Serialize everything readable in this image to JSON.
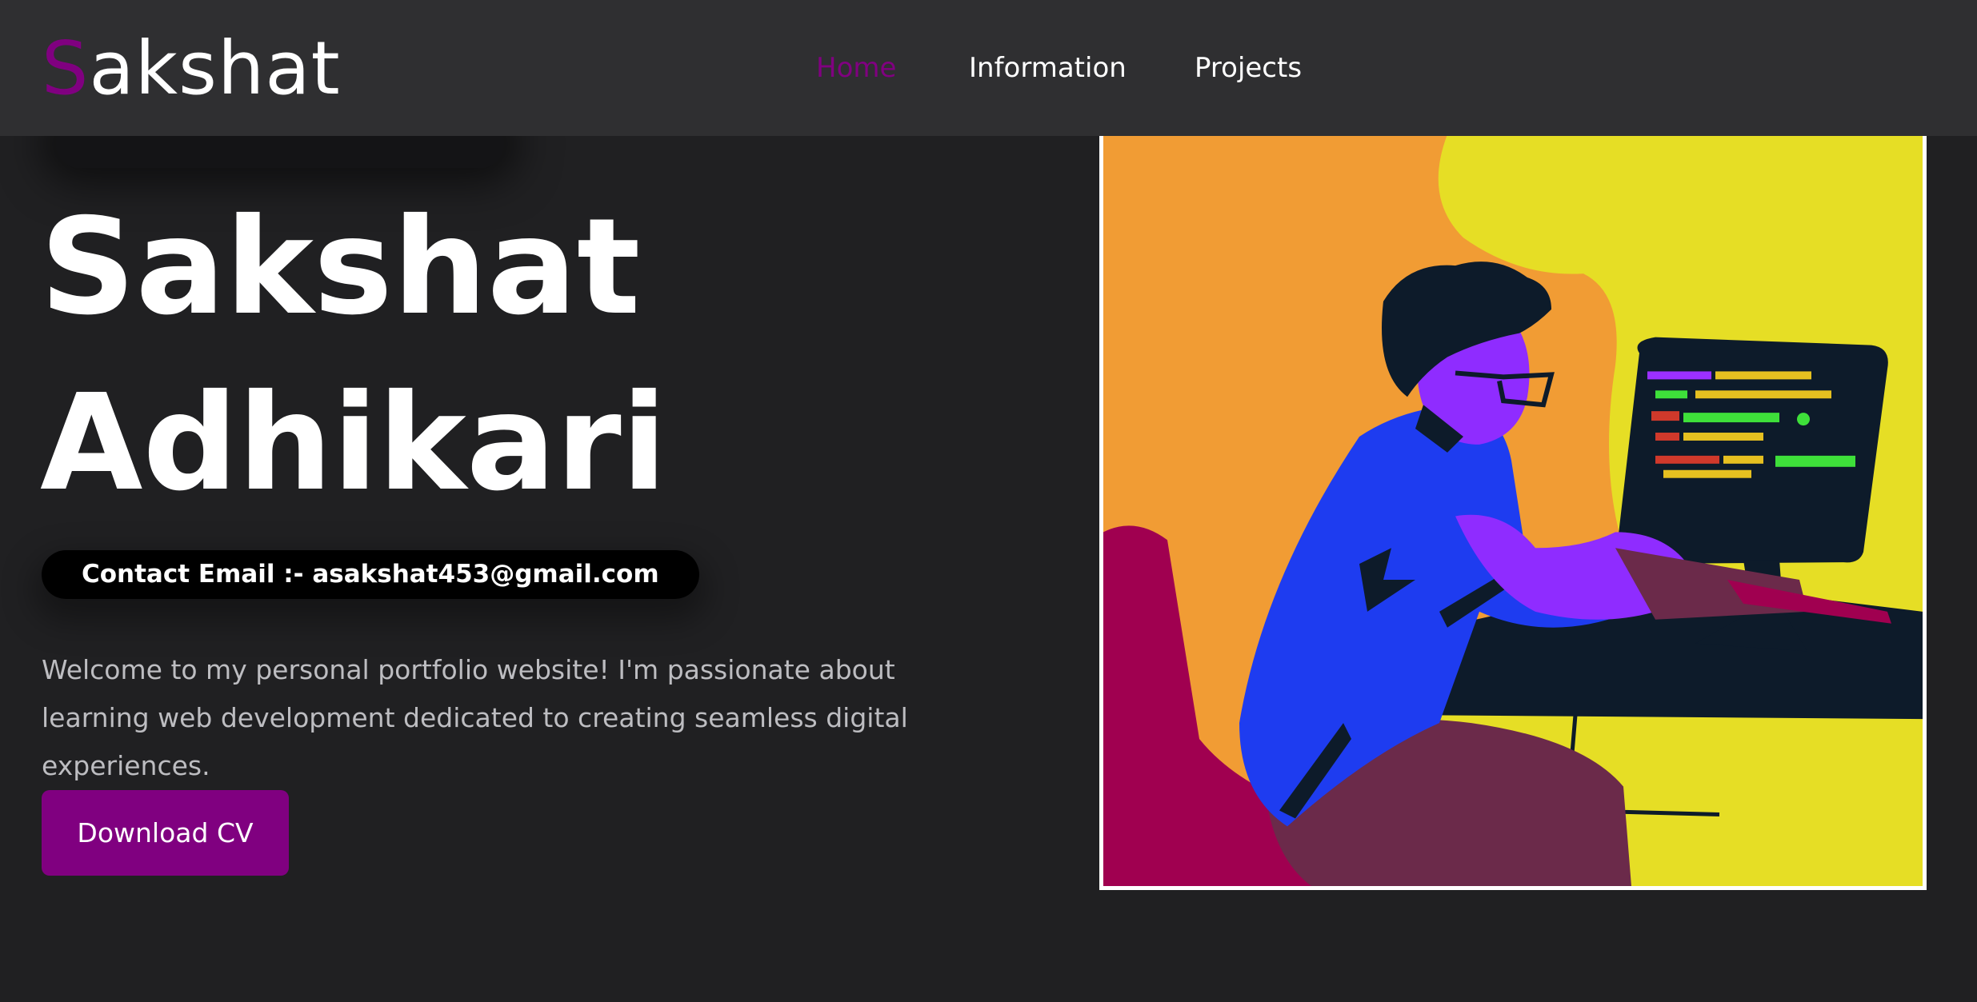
{
  "header": {
    "logo_first_letter": "S",
    "logo_rest": "akshat",
    "nav": [
      {
        "label": "Home",
        "active": true
      },
      {
        "label": "Information",
        "active": false
      },
      {
        "label": "Projects",
        "active": false
      }
    ]
  },
  "hero": {
    "name_line1": "Sakshat",
    "name_line2": "Adhikari",
    "email_label": "Contact Email :- asakshat453@gmail.com",
    "intro": "Welcome to my personal portfolio website! I'm passionate about learning web development dedicated to creating seamless digital experiences.",
    "cv_button": "Download CV"
  },
  "illustration": {
    "subject": "person-coding-at-computer"
  },
  "colors": {
    "accent": "#800080",
    "background": "#202022",
    "navbar": "#2f2f31",
    "pill": "#000000",
    "text_muted": "#bdbdc1"
  }
}
